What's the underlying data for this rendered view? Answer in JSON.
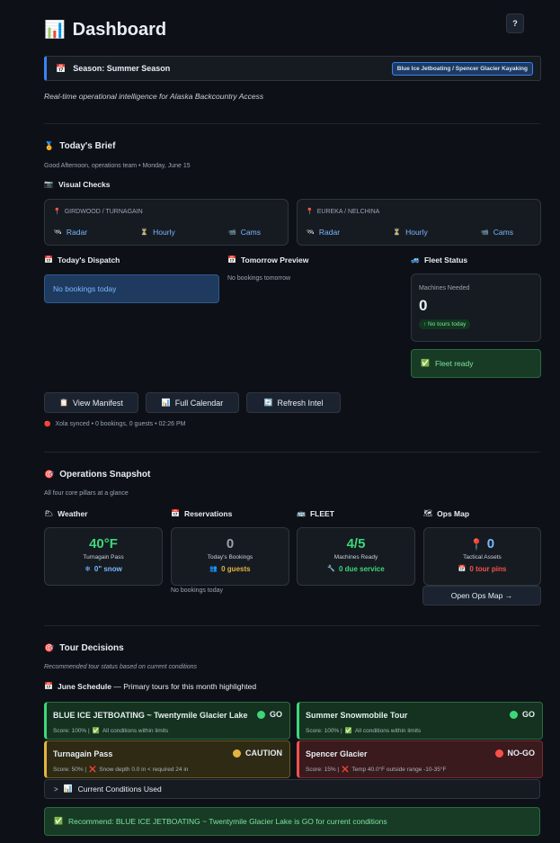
{
  "header": {
    "title": "Dashboard",
    "title_icon": "📊",
    "help_label": "?"
  },
  "season": {
    "icon": "📅",
    "label": "Season: Summer Season",
    "badge": "Blue Ice Jetboating / Spencer Glacier Kayaking"
  },
  "tagline": "Real-time operational intelligence for Alaska Backcountry Access",
  "brief": {
    "title": "Today's Brief",
    "icon": "🏅",
    "greeting": "Good Afternoon, operations team • Monday, June 15",
    "visual_checks_title": "Visual Checks",
    "visual_checks_icon": "📷",
    "regions": [
      {
        "pin": "📍",
        "name": "GIRDWOOD / TURNAGAIN",
        "links": [
          {
            "icon": "🛰",
            "label": "Radar"
          },
          {
            "icon": "⏳",
            "label": "Hourly"
          },
          {
            "icon": "📹",
            "label": "Cams"
          }
        ]
      },
      {
        "pin": "📍",
        "name": "EUREKA / NELCHINA",
        "links": [
          {
            "icon": "🛰",
            "label": "Radar"
          },
          {
            "icon": "⏳",
            "label": "Hourly"
          },
          {
            "icon": "📹",
            "label": "Cams"
          }
        ]
      }
    ],
    "dispatch": {
      "title": "Today's Dispatch",
      "icon": "📅",
      "empty": "No bookings today"
    },
    "tomorrow": {
      "title": "Tomorrow Preview",
      "icon": "📅",
      "empty": "No bookings tomorrow"
    },
    "fleet": {
      "title": "Fleet Status",
      "icon": "🚙",
      "machines_label": "Machines Needed",
      "machines_value": "0",
      "badge": "↑ No tours today",
      "ready": "Fleet ready",
      "ready_icon": "✅"
    },
    "actions": [
      {
        "icon": "📋",
        "label": "View Manifest"
      },
      {
        "icon": "📊",
        "label": "Full Calendar"
      },
      {
        "icon": "🔄",
        "label": "Refresh Intel"
      }
    ],
    "sync": {
      "icon": "🔴",
      "text": "Xola synced • 0 bookings, 0 guests • 02:26 PM"
    }
  },
  "snapshot": {
    "title": "Operations Snapshot",
    "icon": "🎯",
    "subtitle": "All four core pillars at a glance",
    "pillars": [
      {
        "title": "Weather",
        "icon": "🌥",
        "value": "40°F",
        "value_color": "#3fd67a",
        "label": "Turnagain Pass",
        "sub_icon": "❄",
        "sub": "0\" snow",
        "sub_color": "#79b8ff"
      },
      {
        "title": "Reservations",
        "icon": "📅",
        "value": "0",
        "value_color": "#9aa4af",
        "label": "Today's Bookings",
        "sub_icon": "👥",
        "sub": "0 guests",
        "sub_color": "#e3b341"
      },
      {
        "title": "FLEET",
        "icon": "🚌",
        "value": "4/5",
        "value_color": "#3fd67a",
        "label": "Machines Ready",
        "sub_icon": "🔧",
        "sub": "0 due service",
        "sub_color": "#3fd67a"
      },
      {
        "title": "Ops Map",
        "icon": "🗺",
        "value": "0",
        "value_color": "#79b8ff",
        "value_icon": "📍",
        "label": "Tactical Assets",
        "sub_icon": "📅",
        "sub": "0 tour pins",
        "sub_color": "#f85149"
      }
    ],
    "no_bookings": "No bookings today",
    "open_map": "Open Ops Map →"
  },
  "decisions": {
    "title": "Tour Decisions",
    "icon": "🎯",
    "subtitle": "Recommended tour status based on current conditions",
    "schedule_icon": "📅",
    "schedule_bold": "June Schedule",
    "schedule_rest": " — Primary tours for this month highlighted",
    "tours": [
      {
        "name": "BLUE ICE JETBOATING ~ Twentymile Glacier Lake",
        "status": "GO",
        "meta_icon": "✅",
        "score": "Score: 100% |",
        "meta": "All conditions within limits",
        "kind": "go"
      },
      {
        "name": "Summer Snowmobile Tour",
        "status": "GO",
        "meta_icon": "✅",
        "score": "Score: 100% |",
        "meta": "All conditions within limits",
        "kind": "go"
      },
      {
        "name": "Turnagain Pass",
        "status": "CAUTION",
        "meta_icon": "❌",
        "score": "Score: 50% |",
        "meta": "Snow depth 0.0 in < required 24 in",
        "kind": "caution"
      },
      {
        "name": "Spencer Glacier",
        "status": "NO-GO",
        "meta_icon": "❌",
        "score": "Score: 15% |",
        "meta": "Temp 40.0°F outside range -10-35°F",
        "kind": "nogo"
      }
    ],
    "conditions_icon": "📊",
    "conditions_label": "Current Conditions Used",
    "recommend_icon": "✅",
    "recommend": "Recommend: BLUE ICE JETBOATING ~ Twentymile Glacier Lake is GO for current conditions"
  }
}
